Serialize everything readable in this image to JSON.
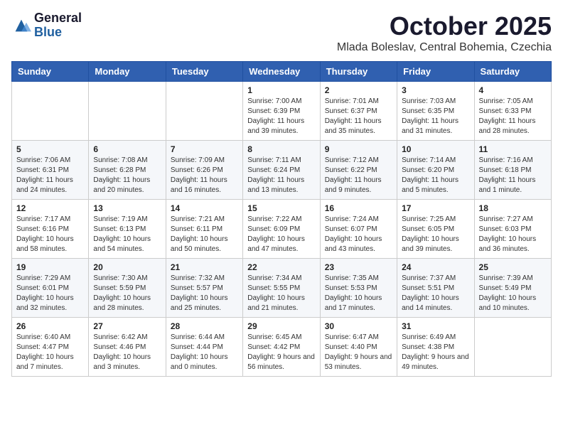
{
  "header": {
    "logo_line1": "General",
    "logo_line2": "Blue",
    "month_title": "October 2025",
    "location": "Mlada Boleslav, Central Bohemia, Czechia"
  },
  "weekdays": [
    "Sunday",
    "Monday",
    "Tuesday",
    "Wednesday",
    "Thursday",
    "Friday",
    "Saturday"
  ],
  "weeks": [
    [
      {
        "day": "",
        "info": ""
      },
      {
        "day": "",
        "info": ""
      },
      {
        "day": "",
        "info": ""
      },
      {
        "day": "1",
        "info": "Sunrise: 7:00 AM\nSunset: 6:39 PM\nDaylight: 11 hours\nand 39 minutes."
      },
      {
        "day": "2",
        "info": "Sunrise: 7:01 AM\nSunset: 6:37 PM\nDaylight: 11 hours\nand 35 minutes."
      },
      {
        "day": "3",
        "info": "Sunrise: 7:03 AM\nSunset: 6:35 PM\nDaylight: 11 hours\nand 31 minutes."
      },
      {
        "day": "4",
        "info": "Sunrise: 7:05 AM\nSunset: 6:33 PM\nDaylight: 11 hours\nand 28 minutes."
      }
    ],
    [
      {
        "day": "5",
        "info": "Sunrise: 7:06 AM\nSunset: 6:31 PM\nDaylight: 11 hours\nand 24 minutes."
      },
      {
        "day": "6",
        "info": "Sunrise: 7:08 AM\nSunset: 6:28 PM\nDaylight: 11 hours\nand 20 minutes."
      },
      {
        "day": "7",
        "info": "Sunrise: 7:09 AM\nSunset: 6:26 PM\nDaylight: 11 hours\nand 16 minutes."
      },
      {
        "day": "8",
        "info": "Sunrise: 7:11 AM\nSunset: 6:24 PM\nDaylight: 11 hours\nand 13 minutes."
      },
      {
        "day": "9",
        "info": "Sunrise: 7:12 AM\nSunset: 6:22 PM\nDaylight: 11 hours\nand 9 minutes."
      },
      {
        "day": "10",
        "info": "Sunrise: 7:14 AM\nSunset: 6:20 PM\nDaylight: 11 hours\nand 5 minutes."
      },
      {
        "day": "11",
        "info": "Sunrise: 7:16 AM\nSunset: 6:18 PM\nDaylight: 11 hours\nand 1 minute."
      }
    ],
    [
      {
        "day": "12",
        "info": "Sunrise: 7:17 AM\nSunset: 6:16 PM\nDaylight: 10 hours\nand 58 minutes."
      },
      {
        "day": "13",
        "info": "Sunrise: 7:19 AM\nSunset: 6:13 PM\nDaylight: 10 hours\nand 54 minutes."
      },
      {
        "day": "14",
        "info": "Sunrise: 7:21 AM\nSunset: 6:11 PM\nDaylight: 10 hours\nand 50 minutes."
      },
      {
        "day": "15",
        "info": "Sunrise: 7:22 AM\nSunset: 6:09 PM\nDaylight: 10 hours\nand 47 minutes."
      },
      {
        "day": "16",
        "info": "Sunrise: 7:24 AM\nSunset: 6:07 PM\nDaylight: 10 hours\nand 43 minutes."
      },
      {
        "day": "17",
        "info": "Sunrise: 7:25 AM\nSunset: 6:05 PM\nDaylight: 10 hours\nand 39 minutes."
      },
      {
        "day": "18",
        "info": "Sunrise: 7:27 AM\nSunset: 6:03 PM\nDaylight: 10 hours\nand 36 minutes."
      }
    ],
    [
      {
        "day": "19",
        "info": "Sunrise: 7:29 AM\nSunset: 6:01 PM\nDaylight: 10 hours\nand 32 minutes."
      },
      {
        "day": "20",
        "info": "Sunrise: 7:30 AM\nSunset: 5:59 PM\nDaylight: 10 hours\nand 28 minutes."
      },
      {
        "day": "21",
        "info": "Sunrise: 7:32 AM\nSunset: 5:57 PM\nDaylight: 10 hours\nand 25 minutes."
      },
      {
        "day": "22",
        "info": "Sunrise: 7:34 AM\nSunset: 5:55 PM\nDaylight: 10 hours\nand 21 minutes."
      },
      {
        "day": "23",
        "info": "Sunrise: 7:35 AM\nSunset: 5:53 PM\nDaylight: 10 hours\nand 17 minutes."
      },
      {
        "day": "24",
        "info": "Sunrise: 7:37 AM\nSunset: 5:51 PM\nDaylight: 10 hours\nand 14 minutes."
      },
      {
        "day": "25",
        "info": "Sunrise: 7:39 AM\nSunset: 5:49 PM\nDaylight: 10 hours\nand 10 minutes."
      }
    ],
    [
      {
        "day": "26",
        "info": "Sunrise: 6:40 AM\nSunset: 4:47 PM\nDaylight: 10 hours\nand 7 minutes."
      },
      {
        "day": "27",
        "info": "Sunrise: 6:42 AM\nSunset: 4:46 PM\nDaylight: 10 hours\nand 3 minutes."
      },
      {
        "day": "28",
        "info": "Sunrise: 6:44 AM\nSunset: 4:44 PM\nDaylight: 10 hours\nand 0 minutes."
      },
      {
        "day": "29",
        "info": "Sunrise: 6:45 AM\nSunset: 4:42 PM\nDaylight: 9 hours\nand 56 minutes."
      },
      {
        "day": "30",
        "info": "Sunrise: 6:47 AM\nSunset: 4:40 PM\nDaylight: 9 hours\nand 53 minutes."
      },
      {
        "day": "31",
        "info": "Sunrise: 6:49 AM\nSunset: 4:38 PM\nDaylight: 9 hours\nand 49 minutes."
      },
      {
        "day": "",
        "info": ""
      }
    ]
  ]
}
